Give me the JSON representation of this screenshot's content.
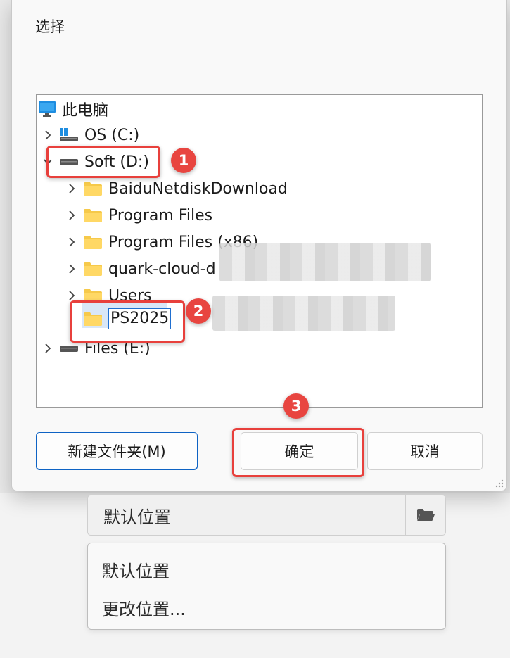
{
  "dialog": {
    "title": "选择",
    "tree": {
      "root": "此电脑",
      "drives": [
        {
          "label": "OS (C:)"
        },
        {
          "label": "Soft (D:)"
        },
        {
          "label": "Files (E:)"
        }
      ],
      "folders": [
        {
          "label": "BaiduNetdiskDownload"
        },
        {
          "label": "Program Files"
        },
        {
          "label": "Program Files (x86)"
        },
        {
          "label": "quark-cloud-d"
        },
        {
          "label": "Users"
        }
      ],
      "rename_value": "PS2025"
    },
    "buttons": {
      "new_folder": "新建文件夹(M)",
      "ok": "确定",
      "cancel": "取消"
    }
  },
  "annotations": {
    "badge_1": "1",
    "badge_2": "2",
    "badge_3": "3"
  },
  "location": {
    "value": "默认位置",
    "folder_icon": "folder-open-icon",
    "options": [
      "默认位置",
      "更改位置..."
    ]
  },
  "colors": {
    "accent": "#0e63c4",
    "annotation_red": "#e8403c",
    "folder_yellow": "#f6c94a"
  }
}
